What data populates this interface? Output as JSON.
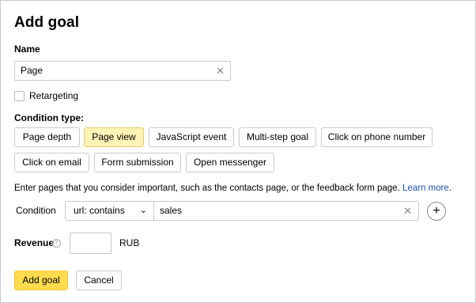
{
  "dialog": {
    "title": "Add goal"
  },
  "name": {
    "label": "Name",
    "value": "Page",
    "clear_icon": "close-icon"
  },
  "retargeting": {
    "label": "Retargeting",
    "checked": false
  },
  "condition_type": {
    "label": "Condition type:",
    "selected": "Page view",
    "options": [
      "Page depth",
      "Page view",
      "JavaScript event",
      "Multi-step goal",
      "Click on phone number",
      "Click on email",
      "Form submission",
      "Open messenger"
    ]
  },
  "info": {
    "text": "Enter pages that you consider important, such as the contacts page, or the feedback form page.",
    "link": "Learn more",
    "suffix": "."
  },
  "condition": {
    "label": "Condition",
    "operator": "url: contains",
    "value": "sales",
    "add_icon": "plus-icon"
  },
  "revenue": {
    "label": "Revenue",
    "value": "",
    "currency": "RUB",
    "help_icon": "question-icon"
  },
  "actions": {
    "submit": "Add goal",
    "cancel": "Cancel"
  },
  "colors": {
    "accent_yellow": "#ffdb4d",
    "selected_option_bg": "#fff3b6",
    "link_blue": "#1d56b6"
  }
}
